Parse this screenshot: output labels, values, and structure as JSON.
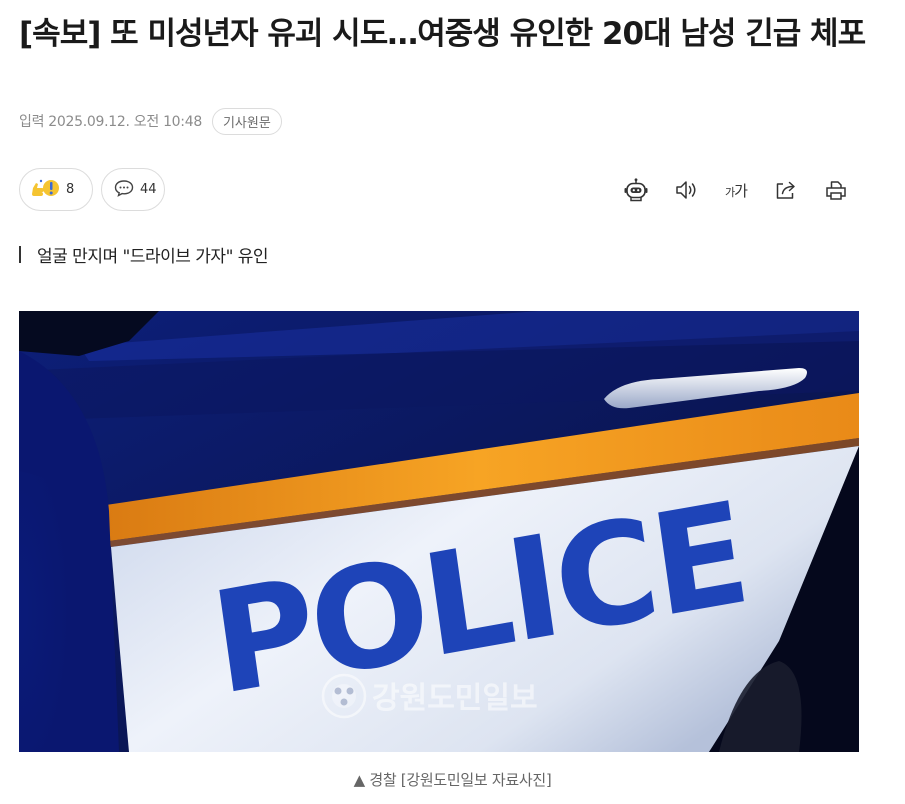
{
  "article": {
    "headline": "[속보] 또 미성년자 유괴 시도…여중생 유인한 20대 남성 긴급 체포",
    "date": "입력 2025.09.12. 오전 10:48",
    "source_badge": "기사원문",
    "subheadline": "얼굴 만지며 \"드라이브 가자\" 유인"
  },
  "reactions": {
    "reaction_count": "8",
    "comment_count": "44"
  },
  "toolbar": {
    "font_size_small": "가",
    "font_size_large": "가",
    "icons": [
      "robot-summary-icon",
      "speaker-icon",
      "font-size-icon",
      "share-icon",
      "print-icon"
    ]
  },
  "photo": {
    "door_text": "POLICE",
    "watermark": "강원도민일보",
    "caption": "▲ 경찰 [강원도민일보 자료사진]"
  },
  "colors": {
    "headline": "#1a1a1a",
    "meta": "#8c8c8c",
    "border": "#dcdcdc",
    "police_blue": "#1e44b8",
    "stripe_orange": "#f39a1e",
    "panel_white": "#e6ecf6"
  }
}
